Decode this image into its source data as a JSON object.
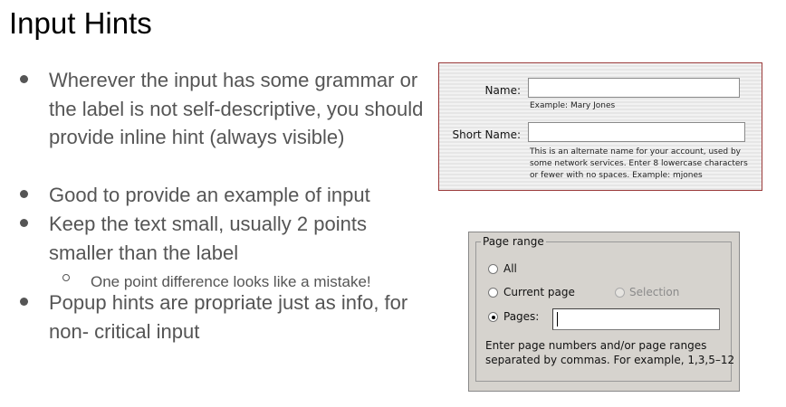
{
  "slide": {
    "title": "Input Hints"
  },
  "bullets": [
    {
      "text": "Wherever the input has some grammar or the label is not self-descriptive, you should provide inline hint (always visible)"
    },
    {
      "text": "Good to provide an example of input"
    },
    {
      "text": "Keep the text small, usually 2 points smaller than the label"
    },
    {
      "text": "Popup hints are propriate just as info, for non- critical input"
    }
  ],
  "sub_bullet": {
    "text": "One point difference looks like a mistake!"
  },
  "mac_form": {
    "name_label": "Name:",
    "name_value": "",
    "name_hint": "Example: Mary Jones",
    "short_name_label": "Short Name:",
    "short_name_value": "",
    "short_name_hint_lines": [
      "This is an alternate name for your account, used by",
      "some network services. Enter 8 lowercase characters",
      "or fewer with no spaces. Example: mjones"
    ]
  },
  "page_range": {
    "legend": "Page range",
    "all_label": "All",
    "current_page_label": "Current page",
    "selection_label": "Selection",
    "pages_label": "Pages:",
    "pages_value": "",
    "instructions_lines": [
      "Enter page numbers and/or page ranges",
      "separated by commas.  For example, 1,3,5–12"
    ]
  }
}
